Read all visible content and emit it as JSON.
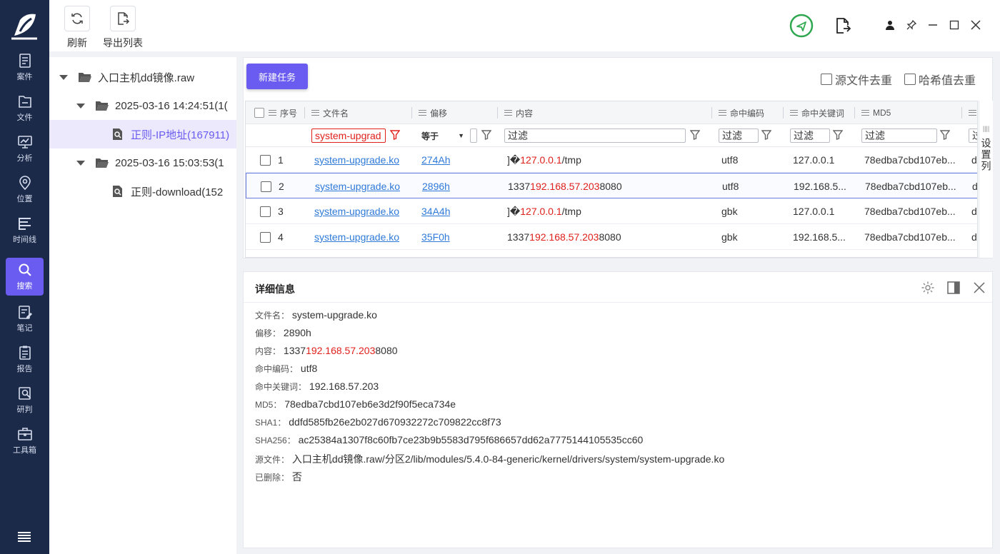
{
  "sidebar": {
    "items": [
      {
        "label": "案件",
        "icon": "case-icon"
      },
      {
        "label": "文件",
        "icon": "file-icon"
      },
      {
        "label": "分析",
        "icon": "analysis-icon"
      },
      {
        "label": "位置",
        "icon": "location-icon"
      },
      {
        "label": "时间线",
        "icon": "timeline-icon"
      },
      {
        "label": "搜索",
        "icon": "search-icon",
        "active": true
      },
      {
        "label": "笔记",
        "icon": "note-icon"
      },
      {
        "label": "报告",
        "icon": "report-icon"
      },
      {
        "label": "研判",
        "icon": "judge-icon"
      },
      {
        "label": "工具箱",
        "icon": "toolbox-icon"
      }
    ]
  },
  "toolbar": {
    "refresh_label": "刷新",
    "export_label": "导出列表"
  },
  "tree": {
    "root": "入口主机dd镜像.raw",
    "task1": "2025-03-16 14:24:51(1(",
    "task1_child": "正则-IP地址(167911)",
    "task2": "2025-03-16 15:03:53(1",
    "task2_child": "正则-download(152"
  },
  "actions": {
    "new_task": "新建任务",
    "dedup_source": "源文件去重",
    "dedup_hash": "哈希值去重"
  },
  "grid": {
    "headers": {
      "index": "序号",
      "filename": "文件名",
      "offset": "偏移",
      "content": "内容",
      "encoding": "命中编码",
      "keyword": "命中关键词",
      "md5": "MD5"
    },
    "filters": {
      "filename": "system-upgrad",
      "offset_op": "等于",
      "placeholder": "过滤"
    },
    "set_columns": "设置列",
    "rows": [
      {
        "index": "1",
        "filename": "system-upgrade.ko",
        "offset": "274Ah",
        "content_pre": "]�",
        "content_hit": "127.0.0.1",
        "content_post": "/tmp",
        "encoding": "utf8",
        "keyword": "127.0.0.1",
        "md5": "78edba7cbd107eb...",
        "extra": "d"
      },
      {
        "index": "2",
        "filename": "system-upgrade.ko",
        "offset": "2896h",
        "content_pre": "1337",
        "content_hit": "192.168.57.203",
        "content_post": "8080",
        "encoding": "utf8",
        "keyword": "192.168.5...",
        "md5": "78edba7cbd107eb...",
        "extra": "d"
      },
      {
        "index": "3",
        "filename": "system-upgrade.ko",
        "offset": "34A4h",
        "content_pre": "]�",
        "content_hit": "127.0.0.1",
        "content_post": "/tmp",
        "encoding": "gbk",
        "keyword": "127.0.0.1",
        "md5": "78edba7cbd107eb...",
        "extra": "d"
      },
      {
        "index": "4",
        "filename": "system-upgrade.ko",
        "offset": "35F0h",
        "content_pre": "1337",
        "content_hit": "192.168.57.203",
        "content_post": "8080",
        "encoding": "gbk",
        "keyword": "192.168.5...",
        "md5": "78edba7cbd107eb...",
        "extra": "d"
      }
    ]
  },
  "detail": {
    "title": "详细信息",
    "fields": [
      {
        "key": "文件名：",
        "value": "system-upgrade.ko"
      },
      {
        "key": "偏移：",
        "value": "2890h"
      },
      {
        "key": "内容：",
        "pre": "1337",
        "hit": "192.168.57.203",
        "post": "8080"
      },
      {
        "key": "命中编码：",
        "value": "utf8"
      },
      {
        "key": "命中关键词：",
        "value": "192.168.57.203"
      },
      {
        "key": "MD5：",
        "value": "78edba7cbd107eb6e3d2f90f5eca734e"
      },
      {
        "key": "SHA1：",
        "value": "ddfd585fb26e2b027d670932272c709822cc8f73"
      },
      {
        "key": "SHA256：",
        "value": "ac25384a1307f8c60fb7ce23b9b5583d795f686657dd62a7775144105535cc60"
      },
      {
        "key": "源文件：",
        "value": "入口主机dd镜像.raw/分区2/lib/modules/5.4.0-84-generic/kernel/drivers/system/system-upgrade.ko"
      },
      {
        "key": "已删除：",
        "value": "否"
      }
    ]
  },
  "colors": {
    "sidebar_bg": "#1c2a4a",
    "accent": "#6a5cf0",
    "hit_red": "#e0201b",
    "link_blue": "#2f7ad9",
    "status_green": "#2fa84f"
  }
}
